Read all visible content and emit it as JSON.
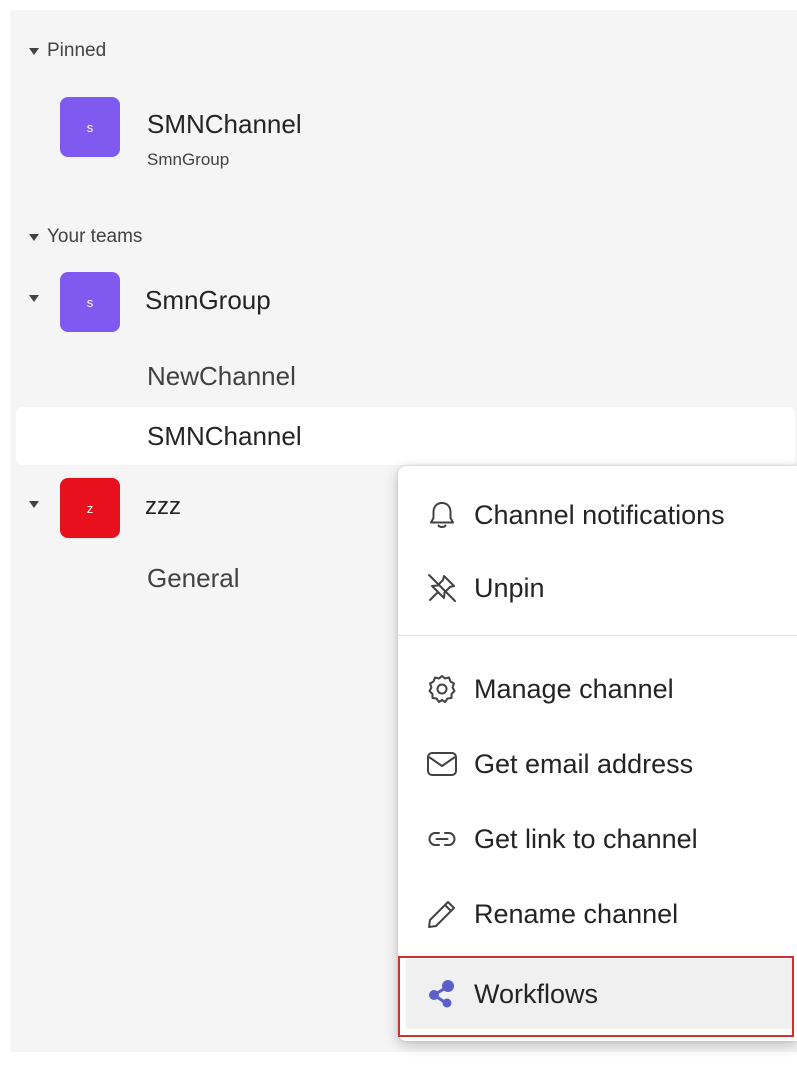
{
  "pinned": {
    "header": "Pinned",
    "item": {
      "avatar_letter": "s",
      "name": "SMNChannel",
      "team": "SmnGroup",
      "avatar_color": "#7f5af0"
    }
  },
  "your_teams": {
    "header": "Your teams",
    "teams": [
      {
        "avatar_letter": "s",
        "name": "SmnGroup",
        "avatar_color": "#7f5af0",
        "channels": [
          "NewChannel",
          "SMNChannel"
        ]
      },
      {
        "avatar_letter": "z",
        "name": "zzz",
        "avatar_color": "#e8101d",
        "channels": [
          "General"
        ]
      }
    ]
  },
  "context_menu": {
    "items": [
      {
        "label": "Channel notifications",
        "icon": "bell-icon"
      },
      {
        "label": "Unpin",
        "icon": "unpin-icon"
      },
      {
        "label": "Manage channel",
        "icon": "gear-icon"
      },
      {
        "label": "Get email address",
        "icon": "mail-icon"
      },
      {
        "label": "Get link to channel",
        "icon": "link-icon"
      },
      {
        "label": "Rename channel",
        "icon": "pencil-icon"
      },
      {
        "label": "Workflows",
        "icon": "workflows-icon"
      }
    ]
  },
  "colors": {
    "highlight_border": "#d32f2f",
    "accent": "#5b5fc7"
  }
}
